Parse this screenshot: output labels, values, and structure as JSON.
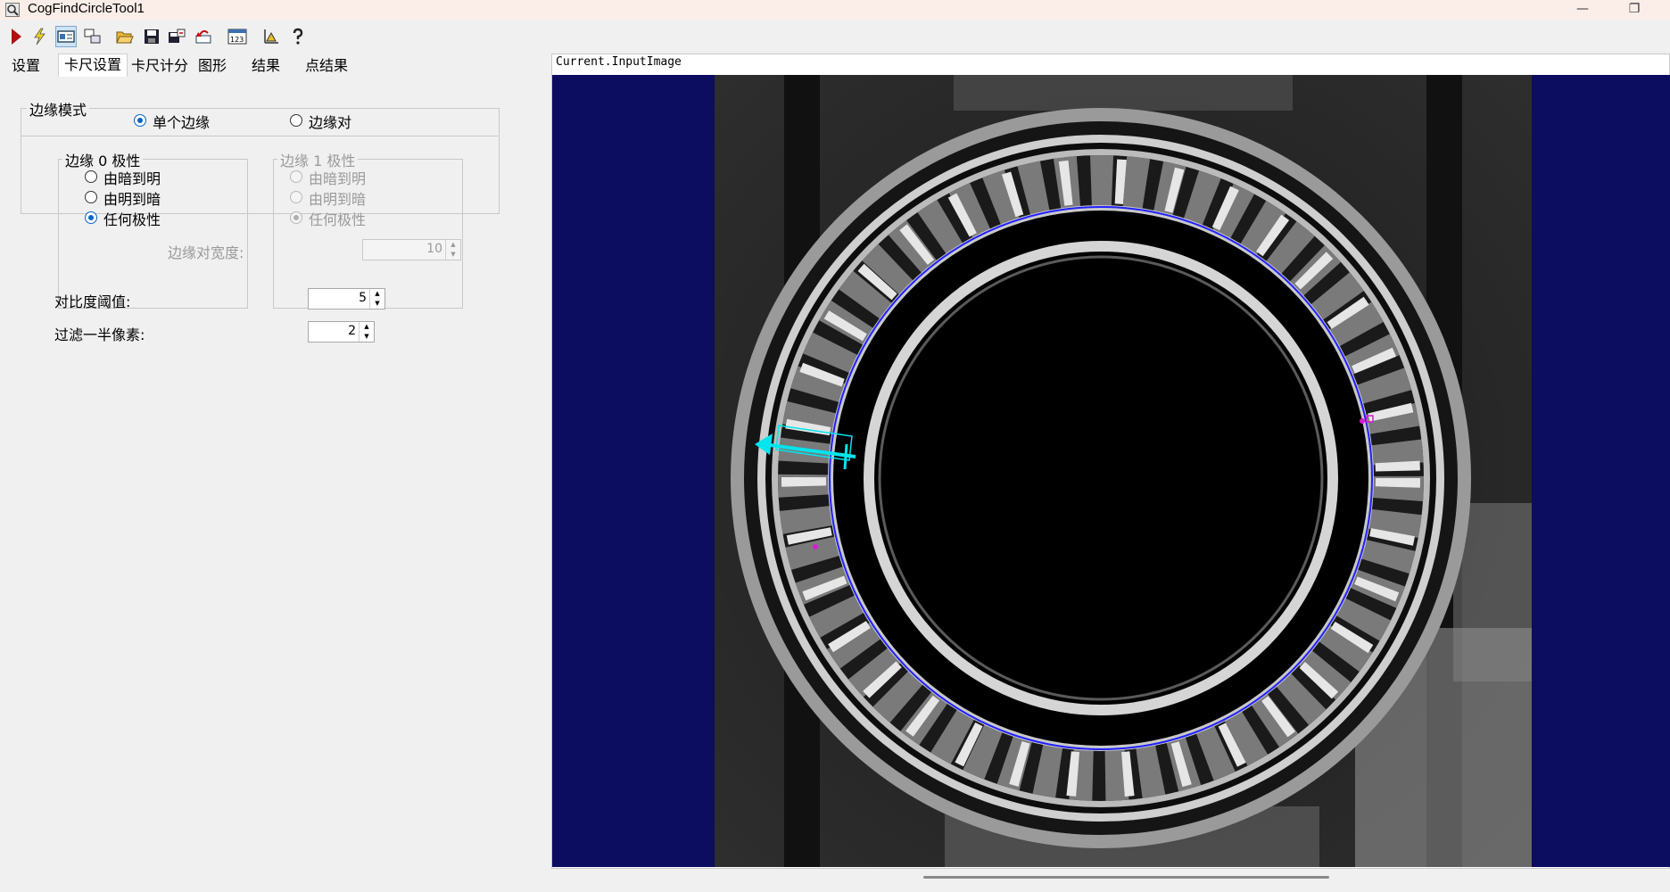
{
  "window": {
    "title": "CogFindCircleTool1",
    "minimize_glyph": "—",
    "restore_glyph": "❐"
  },
  "toolbar": {
    "items": [
      {
        "name": "run-icon"
      },
      {
        "name": "electric-icon"
      },
      {
        "name": "show-image-icon"
      },
      {
        "name": "toggle-display-icon"
      },
      {
        "name": "open-icon"
      },
      {
        "name": "save-icon"
      },
      {
        "name": "save-as-icon"
      },
      {
        "name": "reset-icon"
      },
      {
        "name": "numeric-display-icon"
      },
      {
        "name": "graphics-icon"
      },
      {
        "name": "help-icon"
      }
    ],
    "numeric_label": "123"
  },
  "tabs": [
    {
      "label": "设置"
    },
    {
      "label": "卡尺设置",
      "selected": true
    },
    {
      "label": "卡尺计分"
    },
    {
      "label": "图形"
    },
    {
      "label": "结果"
    },
    {
      "label": "点结果"
    }
  ],
  "caliper": {
    "edge_mode": {
      "label": "边缘模式",
      "options": [
        {
          "label": "单个边缘",
          "checked": true
        },
        {
          "label": "边缘对",
          "checked": false
        }
      ]
    },
    "edge0": {
      "label": "边缘 0 极性",
      "options": [
        {
          "label": "由暗到明"
        },
        {
          "label": "由明到暗"
        },
        {
          "label": "任何极性",
          "checked": true
        }
      ]
    },
    "edge1": {
      "label": "边缘 1 极性",
      "disabled": true,
      "options": [
        {
          "label": "由暗到明"
        },
        {
          "label": "由明到暗"
        },
        {
          "label": "任何极性",
          "checked": true
        }
      ]
    },
    "pair_width": {
      "label": "边缘对宽度:",
      "value": "10"
    },
    "contrast": {
      "label": "对比度阈值:",
      "value": "5"
    },
    "filter_half": {
      "label": "过滤一半像素:",
      "value": "2"
    }
  },
  "display": {
    "title": "Current.InputImage",
    "colors": {
      "background": "#0c0c60",
      "fit_circle": "#2020ff",
      "caliper": "#00e5ee",
      "points": "#d020d0"
    }
  }
}
